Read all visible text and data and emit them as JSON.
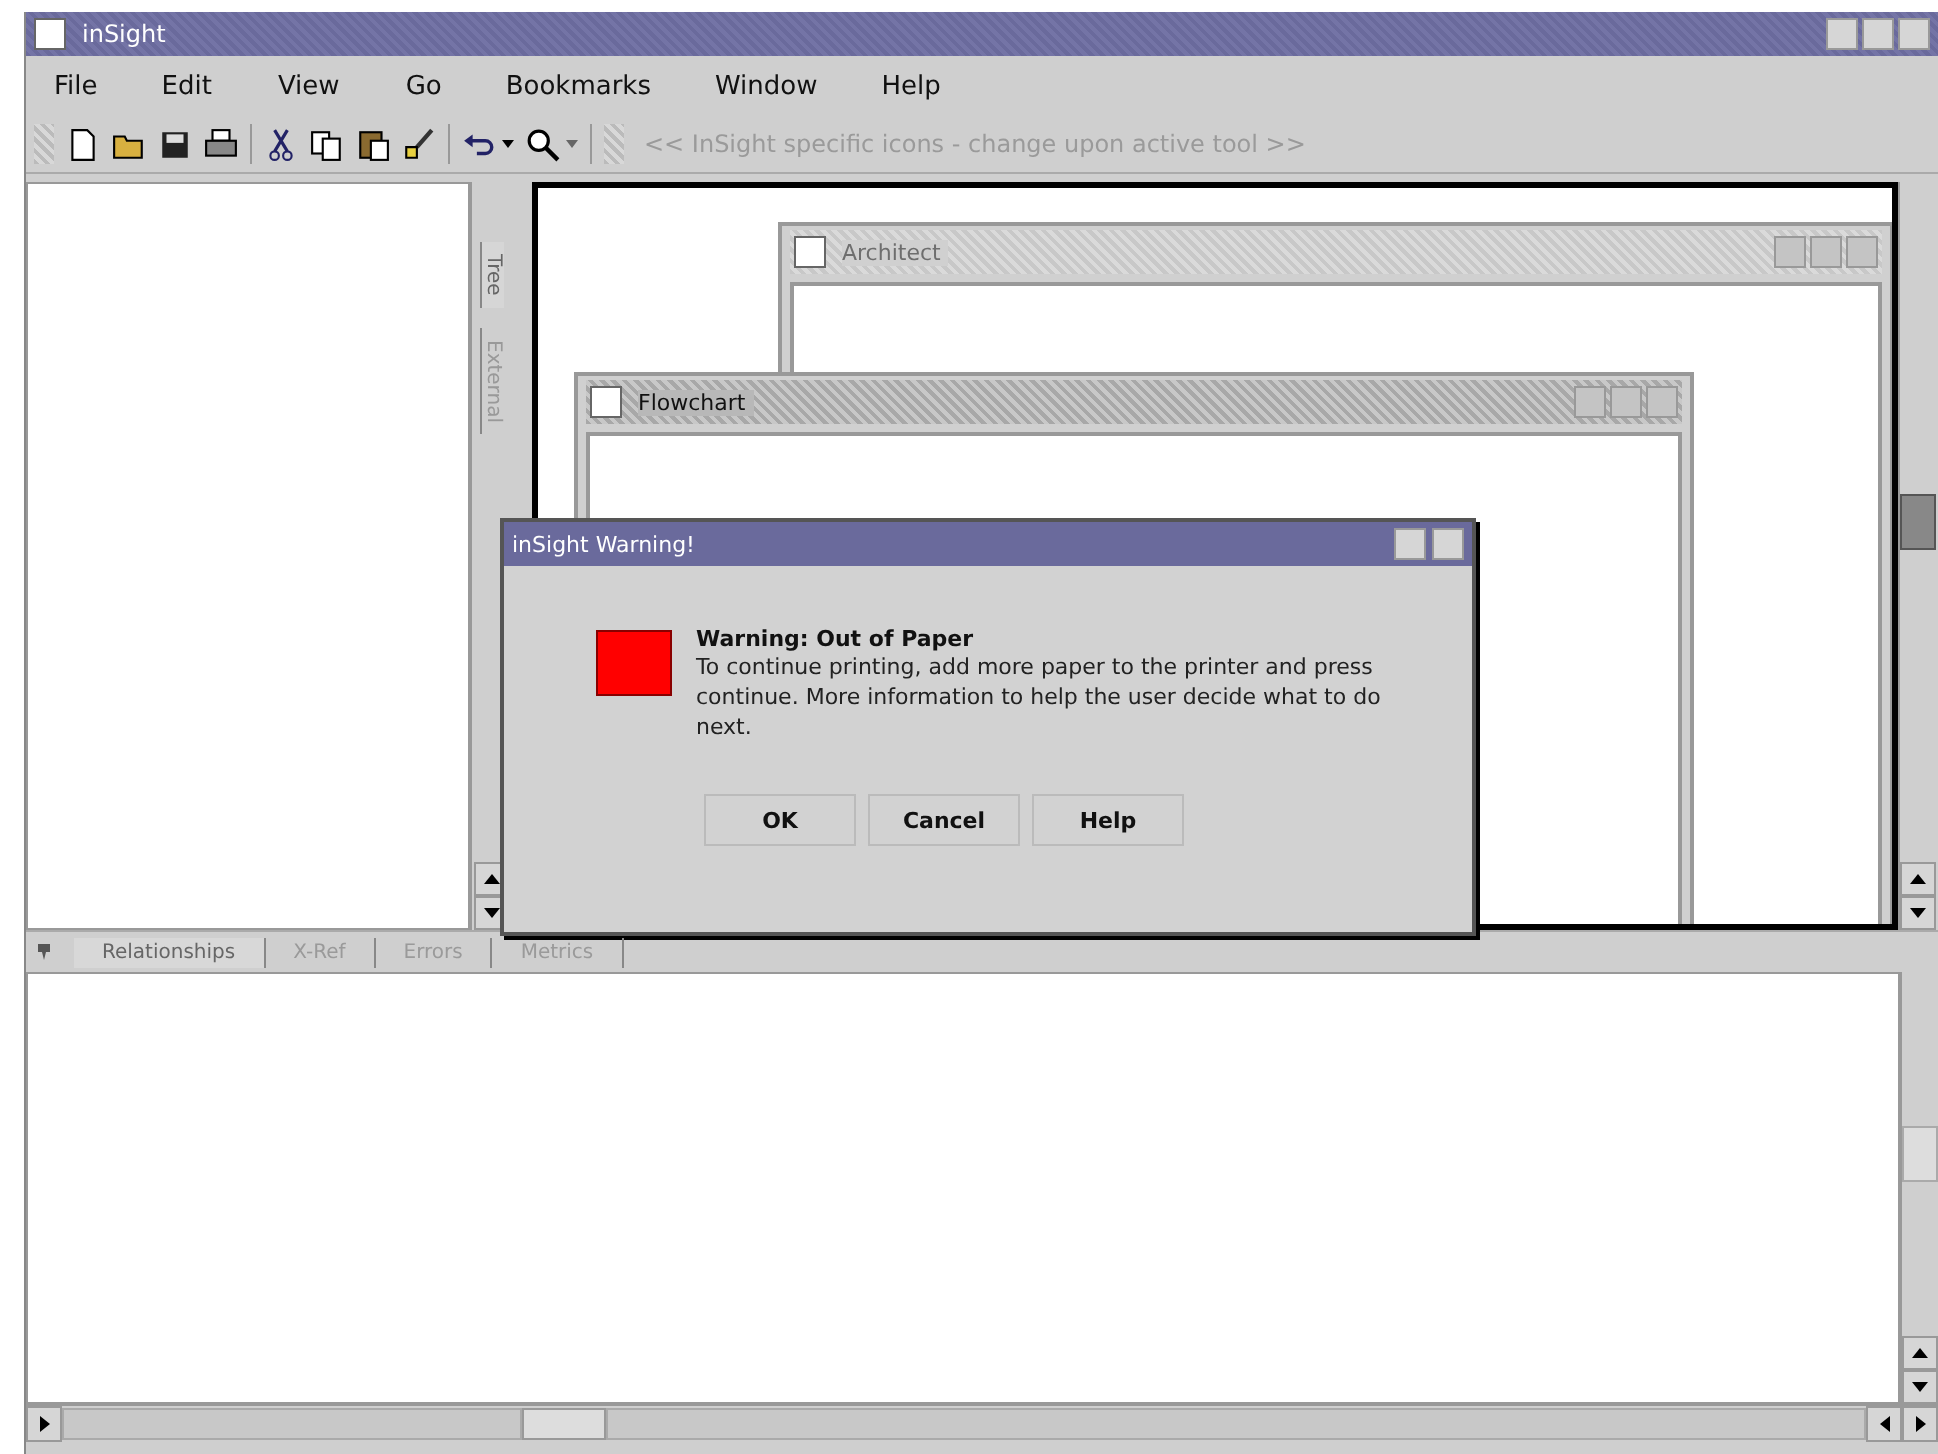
{
  "window": {
    "title": "inSight"
  },
  "menu": [
    "File",
    "Edit",
    "View",
    "Go",
    "Bookmarks",
    "Window",
    "Help"
  ],
  "toolbar": {
    "hint": "<< InSight specific icons - change upon active tool >>"
  },
  "side_tabs": [
    {
      "label": "Tree",
      "selected": true
    },
    {
      "label": "External",
      "selected": false
    }
  ],
  "mdi_windows": [
    {
      "title": "Architect",
      "active": false
    },
    {
      "title": "Flowchart",
      "active": true
    }
  ],
  "dialog": {
    "title": "inSight Warning!",
    "heading": "Warning: Out of Paper",
    "message": "To continue printing, add more paper to the printer and press continue. More information to help the user decide what to do next.",
    "buttons": [
      "OK",
      "Cancel",
      "Help"
    ]
  },
  "bottom_tabs": [
    {
      "label": "Relationships",
      "selected": true
    },
    {
      "label": "X-Ref",
      "selected": false
    },
    {
      "label": "Errors",
      "selected": false
    },
    {
      "label": "Metrics",
      "selected": false
    }
  ]
}
